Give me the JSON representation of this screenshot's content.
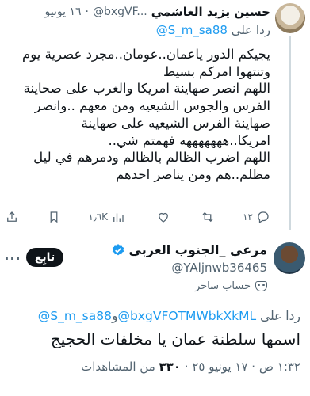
{
  "reply_tweet": {
    "author_name": "حسين يزيد الغاشمي",
    "author_handle": "@bxgVF...",
    "separator": "·",
    "time": "١٦ يونيو",
    "replying_prefix": "ردا على",
    "replying_to": "@S_m_sa88",
    "text": "يجيكم الدور ياعمان..عومان..مجرد عصرية يوم\nوتنتهوا امركم بسيط\nاللهم انصر صهاينة امريكا والغرب على صحاينة\nالفرس والجوس الشيعيه ومن معهم ..وانصر\nصهاينة الفرس الشيعيه على صهاينة\nامريكا..هههههههه فهمتم شي..\nاللهم اضرب الظالم بالظالم ودمرهم في ليل\nمظلم..هم ومن يناصر احدهم",
    "actions": {
      "replies": "١٢",
      "reposts": "",
      "likes": "",
      "views": "١٫٦K"
    }
  },
  "main_tweet": {
    "author_name": "مرعي _الجنوب العربي",
    "author_handle": "@YAljnwb36465",
    "follow_label": "تابِع",
    "more_label": "···",
    "parody_label": "حساب ساخر",
    "replying_prefix": "ردا على",
    "replying_to_1": "@bxgVFOTMWbkXkML",
    "replying_and": "و",
    "replying_to_2": "@S_m_sa88",
    "text": "اسمها سلطنة عمان يا مخلفات الحجيج",
    "time": "١:٣٢ ص",
    "separator": "·",
    "date": "١٧ يونيو ٢٥",
    "views_count": "٣٣٠",
    "views_label": "من المشاهدات"
  },
  "colors": {
    "text": "#0f1419",
    "secondary": "#536471",
    "link": "#1d9bf0",
    "divider": "#cfd9de"
  }
}
